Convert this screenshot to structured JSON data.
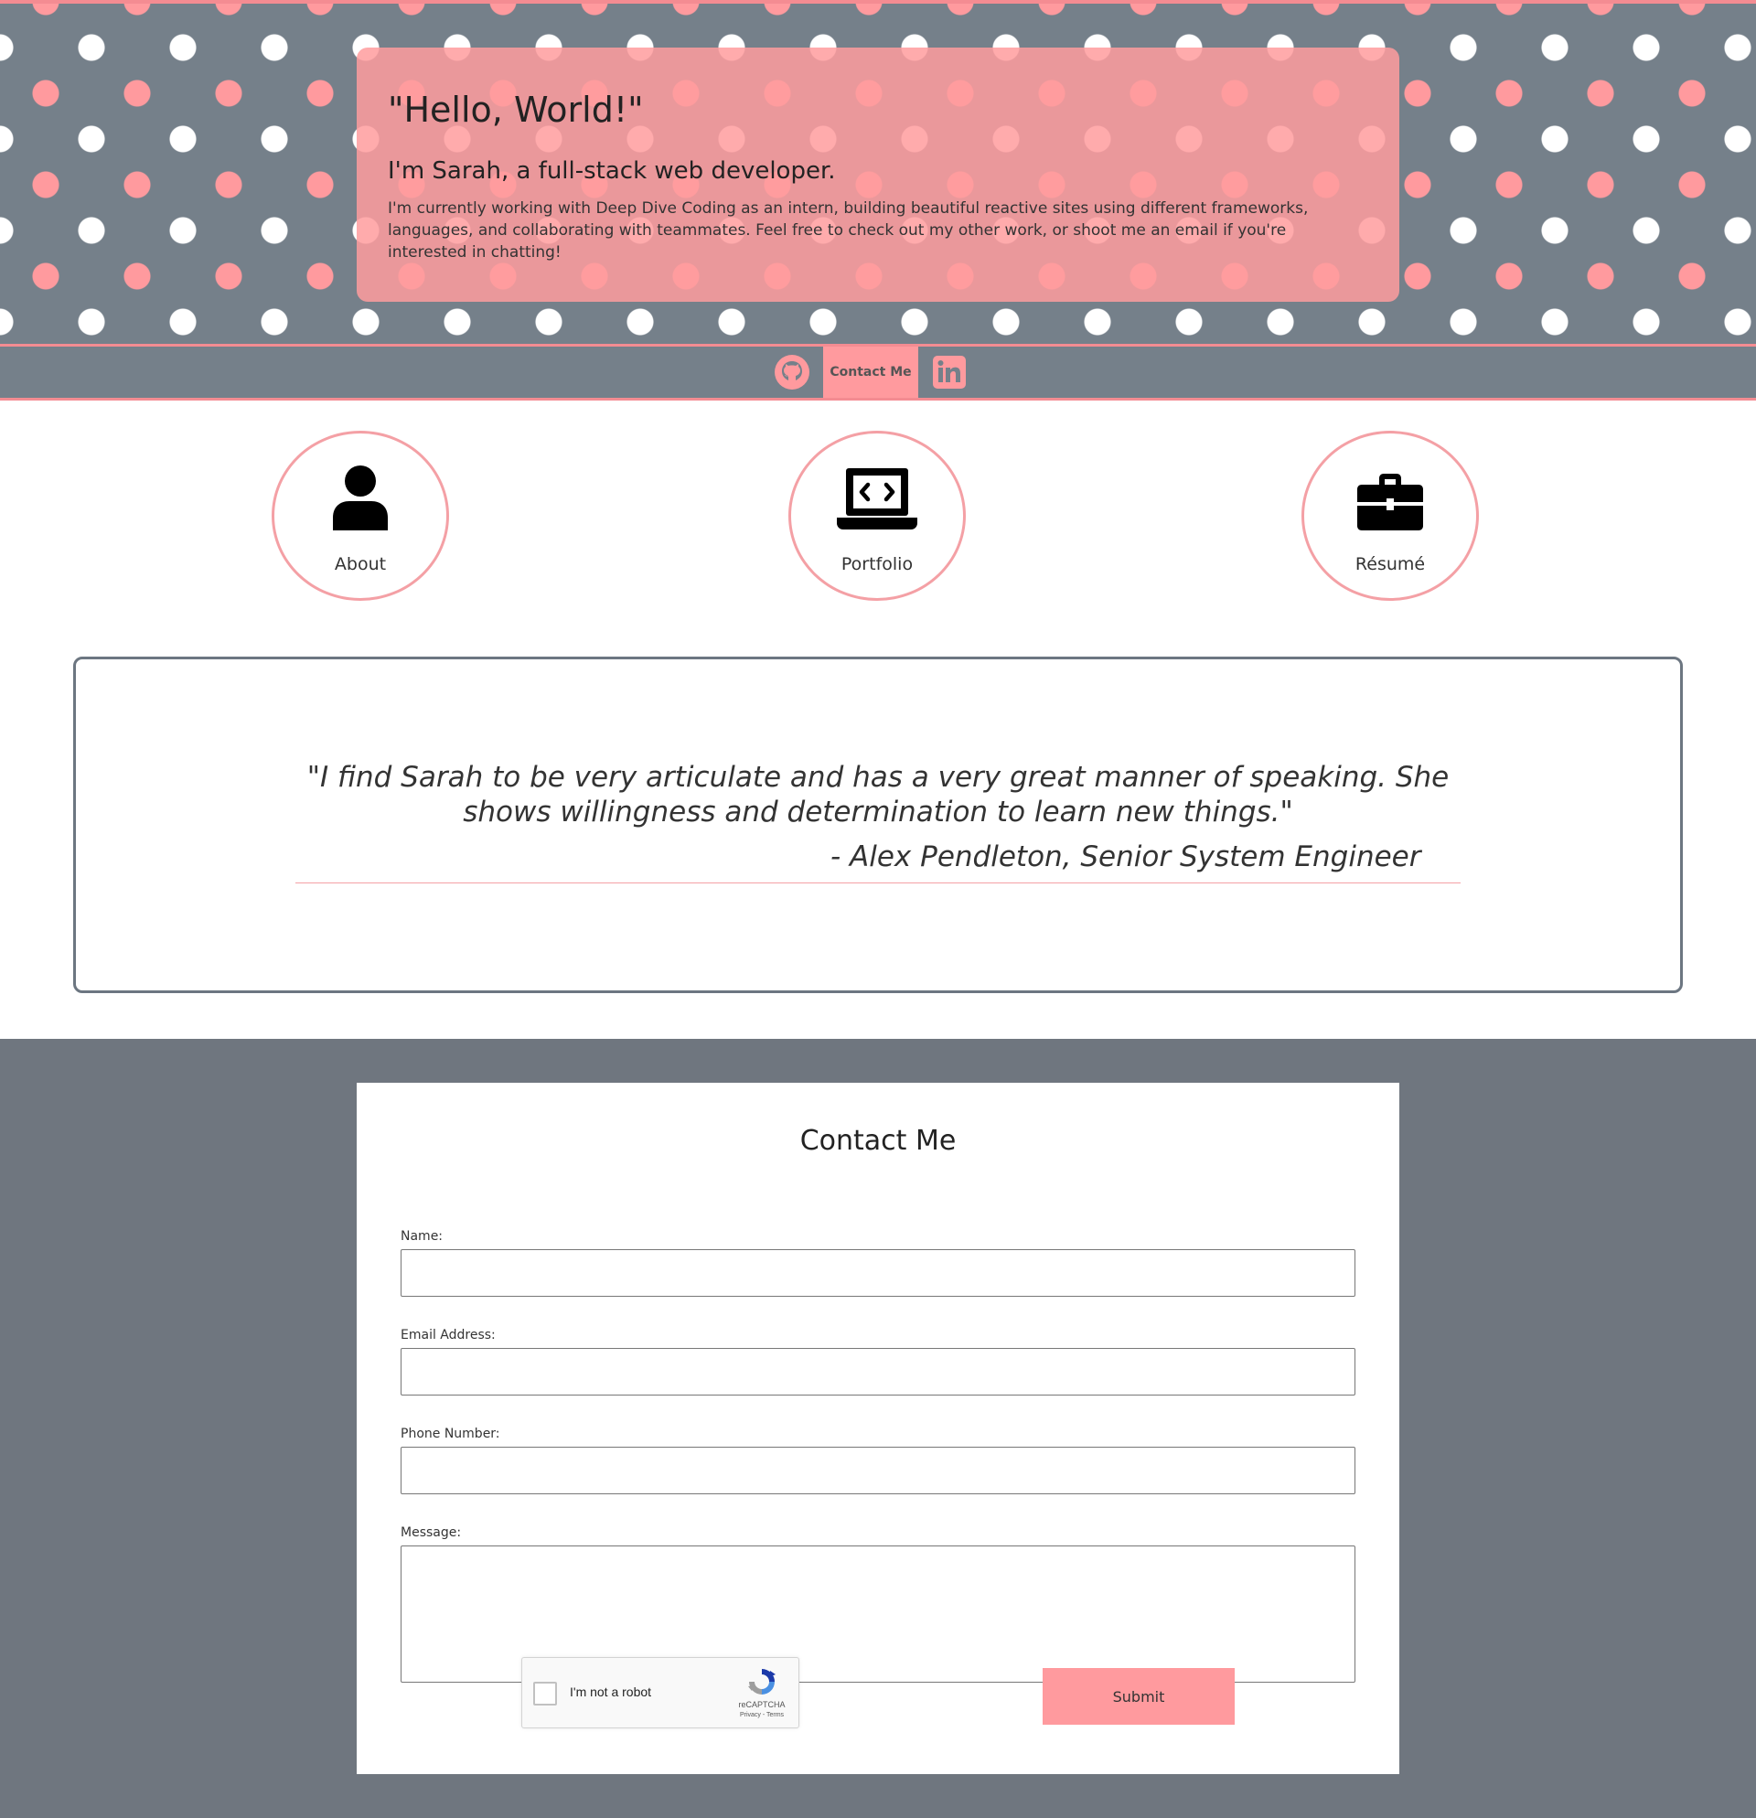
{
  "hero": {
    "title": "\"Hello, World!\"",
    "subtitle": "I'm Sarah, a full-stack web developer.",
    "description": "I'm currently working with Deep Dive Coding as an intern, building beautiful reactive sites using different frameworks, languages, and collaborating with teammates. Feel free to check out my other work, or shoot me an email if you're interested in chatting!"
  },
  "nav": {
    "github_icon": "github-icon",
    "contact_label": "Contact Me",
    "linkedin_icon": "linkedin-icon"
  },
  "features": [
    {
      "label": "About",
      "icon": "user-icon"
    },
    {
      "label": "Portfolio",
      "icon": "laptop-code-icon"
    },
    {
      "label": "Résumé",
      "icon": "briefcase-icon"
    }
  ],
  "testimonial": {
    "quote": "\"I find Sarah to be very articulate and has a very great manner of speaking. She shows willingness and determination to learn new things.\"",
    "author": "- Alex Pendleton, Senior System Engineer"
  },
  "contact": {
    "title": "Contact Me",
    "name_label": "Name:",
    "email_label": "Email Address:",
    "phone_label": "Phone Number:",
    "message_label": "Message:",
    "name_value": "",
    "email_value": "",
    "phone_value": "",
    "message_value": "",
    "recaptcha_label": "I'm not a robot",
    "recaptcha_brand": "reCAPTCHA",
    "recaptcha_terms": "Privacy - Terms",
    "submit_label": "Submit"
  },
  "colors": {
    "accent_pink": "#ff9a9e",
    "slate_gray": "#75808a",
    "section_gray": "#6f767f"
  }
}
